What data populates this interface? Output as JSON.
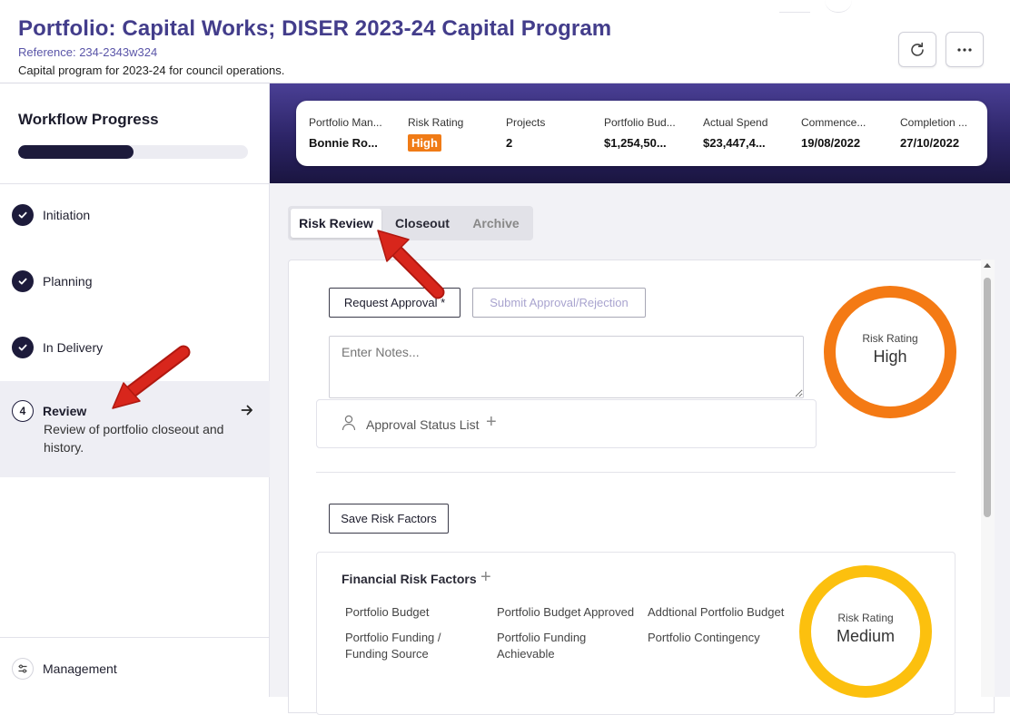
{
  "header": {
    "title": "Portfolio: Capital Works; DISER 2023-24 Capital Program",
    "reference": "Reference: 234-2343w324",
    "description": "Capital program for 2023-24 for council operations.",
    "refresh_icon": "refresh-icon",
    "more_icon": "more-horizontal-icon"
  },
  "sidebar": {
    "title": "Workflow Progress",
    "progress_fraction": 0.5,
    "steps": [
      {
        "label": "Initiation",
        "status": "complete",
        "icon": "check-icon"
      },
      {
        "label": "Planning",
        "status": "complete",
        "icon": "check-icon"
      },
      {
        "label": "In Delivery",
        "status": "complete",
        "icon": "check-icon"
      },
      {
        "label": "Review",
        "number": "4",
        "description": "Review of portfolio closeout and history.",
        "status": "active",
        "icon": "arrow-right-icon"
      }
    ],
    "management": {
      "label": "Management",
      "icon": "sliders-icon"
    }
  },
  "summary": {
    "portfolio_manager": {
      "label": "Portfolio Man...",
      "value": "Bonnie Ro..."
    },
    "risk_rating": {
      "label": "Risk Rating",
      "value": "High",
      "color": "#f07b16"
    },
    "projects": {
      "label": "Projects",
      "value": "2"
    },
    "portfolio_budget": {
      "label": "Portfolio Bud...",
      "value": "$1,254,50..."
    },
    "actual_spend": {
      "label": "Actual Spend",
      "value": "$23,447,4..."
    },
    "commencement": {
      "label": "Commence...",
      "value": "19/08/2022"
    },
    "completion": {
      "label": "Completion ...",
      "value": "27/10/2022"
    }
  },
  "tabs": {
    "risk_review": "Risk Review",
    "closeout": "Closeout",
    "archive": "Archive",
    "active": "Risk Review"
  },
  "risk_review": {
    "request_approval": "Request Approval *",
    "submit_approval": "Submit Approval/Rejection",
    "notes_placeholder": "Enter Notes...",
    "approval_status_list": "Approval Status List",
    "approval_plus": "+",
    "save_risk_factors": "Save Risk Factors",
    "overall_rating": {
      "label": "Risk Rating",
      "value": "High",
      "color": "#f47a14"
    },
    "financial": {
      "title": "Financial Risk Factors",
      "plus": "+",
      "factors": [
        "Portfolio Budget",
        "Portfolio Budget Approved",
        "Addtional Portfolio Budget",
        "Portfolio Funding / Funding Source",
        "Portfolio Funding Achievable",
        "Portfolio Contingency"
      ],
      "rating": {
        "label": "Risk Rating",
        "value": "Medium",
        "color": "#fcc00e"
      }
    }
  },
  "colors": {
    "brand": "#433d8b",
    "sidebar_active": "#1d1b3b",
    "banner": "#2c2466",
    "annotation_arrow": "#d8261c"
  }
}
